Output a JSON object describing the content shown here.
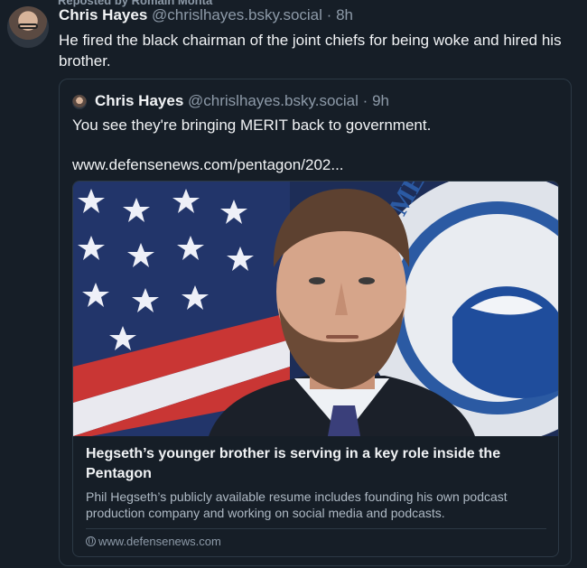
{
  "post": {
    "repost_label": "Reposted by Romain Monta",
    "author_name": "Chris Hayes",
    "handle": "@chrislhayes.bsky.social",
    "separator": "·",
    "time": "8h",
    "text": "He fired the black chairman of the joint chiefs for being woke and hired his brother."
  },
  "quote": {
    "author_name": "Chris Hayes",
    "handle": "@chrislhayes.bsky.social",
    "separator": "·",
    "time": "9h",
    "text": "You see they're bringing MERIT back to government.",
    "link": "www.defensenews.com/pentagon/202..."
  },
  "link_card": {
    "title": "Hegseth’s younger brother is serving in a key role inside the Pentagon",
    "description": "Phil Hegseth’s publicly available resume includes founding his own podcast production company and working on social media and podcasts.",
    "domain": "www.defensenews.com",
    "seal_text": "DEPARTMENT"
  },
  "icons": {
    "domain_icon": "globe-icon",
    "avatar": "profile-photo"
  },
  "colors": {
    "background": "#161e27",
    "text": "#f1f3f5",
    "muted": "#8d9aa8",
    "border": "#2c3945"
  }
}
